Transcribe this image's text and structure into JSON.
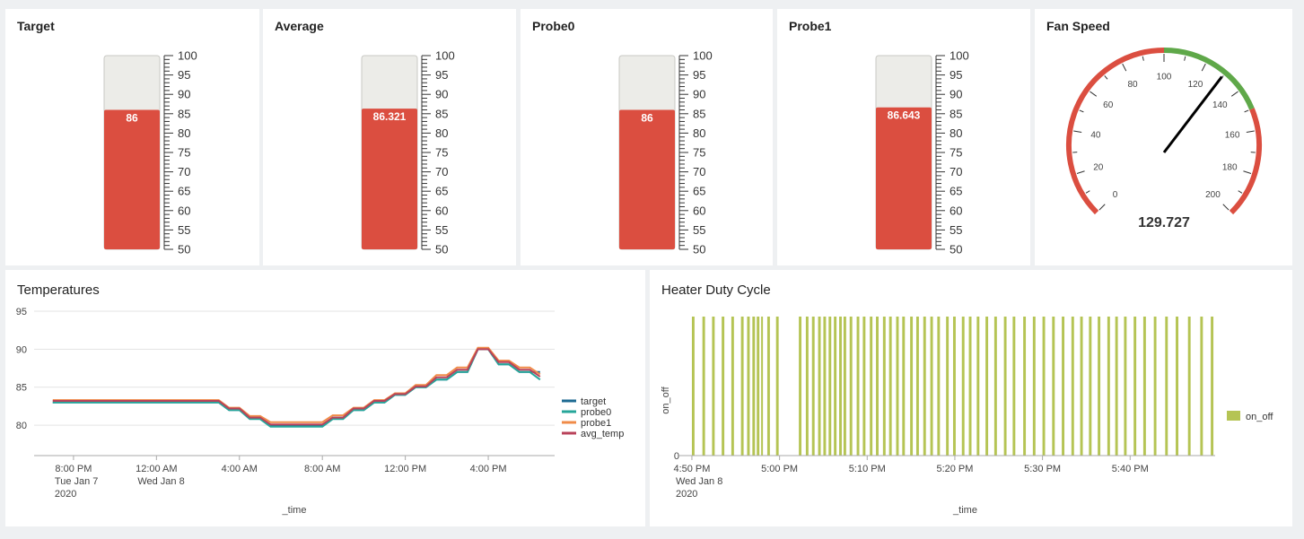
{
  "colors": {
    "red": "#db4e40",
    "green": "#5fa849",
    "empty": "#ecece8",
    "target": "#1d6a92",
    "probe0": "#26a69a",
    "probe1": "#f08b48",
    "avg_temp": "#b9425a",
    "heater": "#b5c454"
  },
  "thermometers": [
    {
      "title": "Target",
      "value": 86,
      "label": "86"
    },
    {
      "title": "Average",
      "value": 86.321,
      "label": "86.321"
    },
    {
      "title": "Probe0",
      "value": 86,
      "label": "86"
    },
    {
      "title": "Probe1",
      "value": 86.643,
      "label": "86.643"
    }
  ],
  "thermo_scale": {
    "min": 50,
    "max": 100,
    "ticks": [
      "100",
      "95",
      "90",
      "85",
      "80",
      "75",
      "70",
      "65",
      "60",
      "55",
      "50"
    ]
  },
  "fan": {
    "title": "Fan Speed",
    "value": 129.727,
    "label": "129.727",
    "min": 0,
    "max": 200,
    "ticks": [
      "0",
      "20",
      "40",
      "60",
      "80",
      "100",
      "120",
      "140",
      "160",
      "180",
      "200"
    ],
    "bands": [
      {
        "from": 0,
        "to": 100,
        "color": "#db4e40"
      },
      {
        "from": 100,
        "to": 150,
        "color": "#5fa849"
      },
      {
        "from": 150,
        "to": 200,
        "color": "#db4e40"
      }
    ]
  },
  "temperatures": {
    "title": "Temperatures",
    "xlabel": "_time",
    "y_ticks": [
      "95",
      "90",
      "85",
      "80"
    ],
    "x_ticks": [
      {
        "l1": "8:00 PM",
        "l2": "Tue Jan 7",
        "l3": "2020"
      },
      {
        "l1": "12:00 AM",
        "l2": "Wed Jan 8",
        "l3": ""
      },
      {
        "l1": "4:00 AM",
        "l2": "",
        "l3": ""
      },
      {
        "l1": "8:00 AM",
        "l2": "",
        "l3": ""
      },
      {
        "l1": "12:00 PM",
        "l2": "",
        "l3": ""
      },
      {
        "l1": "4:00 PM",
        "l2": "",
        "l3": ""
      }
    ],
    "legend": [
      "target",
      "probe0",
      "probe1",
      "avg_temp"
    ]
  },
  "chart_data": [
    {
      "type": "line",
      "title": "Temperatures",
      "xlabel": "_time",
      "ylim": [
        76,
        95
      ],
      "x": [
        -1,
        0,
        1,
        2,
        3,
        4,
        5,
        6,
        7,
        7.5,
        8,
        8.5,
        9,
        9.5,
        10,
        10.5,
        11,
        11.5,
        12,
        12.5,
        13,
        13.5,
        14,
        14.5,
        15,
        15.5,
        16,
        16.5,
        17,
        17.5,
        18,
        18.5,
        19,
        19.5,
        20,
        20.5,
        21,
        21.5,
        22,
        22.5
      ],
      "series": [
        {
          "name": "target",
          "values": [
            83,
            83,
            83,
            83,
            83,
            83,
            83,
            83,
            83,
            82,
            82,
            81,
            81,
            80,
            80,
            80,
            80,
            80,
            80,
            81,
            81,
            82,
            82,
            83,
            83,
            84,
            84,
            85,
            85,
            86,
            86,
            87,
            87,
            90,
            90,
            88,
            88,
            87,
            87,
            87
          ]
        },
        {
          "name": "probe0",
          "values": [
            83,
            83,
            83,
            83,
            83,
            83,
            83,
            83,
            83,
            82,
            82,
            80.8,
            80.8,
            79.8,
            79.8,
            79.8,
            79.8,
            79.8,
            79.8,
            80.8,
            80.8,
            82,
            82,
            83,
            83,
            84,
            84,
            85,
            85,
            86,
            86,
            87,
            87,
            90,
            90,
            88,
            88,
            87,
            87,
            86
          ]
        },
        {
          "name": "probe1",
          "values": [
            83.3,
            83.3,
            83.3,
            83.3,
            83.3,
            83.3,
            83.3,
            83.3,
            83.3,
            82.3,
            82.3,
            81.2,
            81.2,
            80.4,
            80.4,
            80.4,
            80.4,
            80.4,
            80.4,
            81.3,
            81.3,
            82.3,
            82.3,
            83.3,
            83.3,
            84.2,
            84.2,
            85.3,
            85.3,
            86.6,
            86.6,
            87.6,
            87.6,
            90.2,
            90.2,
            88.5,
            88.5,
            87.6,
            87.6,
            86.7
          ]
        },
        {
          "name": "avg_temp",
          "values": [
            83.2,
            83.2,
            83.2,
            83.2,
            83.2,
            83.2,
            83.2,
            83.2,
            83.2,
            82.2,
            82.2,
            81,
            81,
            80.1,
            80.1,
            80.1,
            80.1,
            80.1,
            80.1,
            81,
            81,
            82.2,
            82.2,
            83.2,
            83.2,
            84.1,
            84.1,
            85.1,
            85.1,
            86.3,
            86.3,
            87.3,
            87.3,
            90,
            90,
            88.3,
            88.3,
            87.3,
            87.3,
            86.4
          ]
        }
      ]
    },
    {
      "type": "bar",
      "title": "Heater Duty Cycle",
      "xlabel": "_time",
      "ylabel": "on_off",
      "ylim": [
        0,
        1
      ],
      "legend": [
        "on_off"
      ],
      "on_intervals_minutes": [
        [
          0.0,
          0.3
        ],
        [
          1.2,
          1.5
        ],
        [
          2.3,
          2.6
        ],
        [
          3.4,
          3.7
        ],
        [
          4.5,
          4.8
        ],
        [
          5.6,
          5.9
        ],
        [
          6.3,
          6.6
        ],
        [
          6.9,
          7.2
        ],
        [
          7.4,
          7.7
        ],
        [
          7.9,
          8.1
        ],
        [
          8.6,
          8.9
        ],
        [
          9.6,
          9.9
        ],
        [
          12.2,
          12.5
        ],
        [
          13.0,
          13.3
        ],
        [
          13.7,
          14.0
        ],
        [
          14.4,
          14.7
        ],
        [
          15.0,
          15.3
        ],
        [
          15.6,
          15.9
        ],
        [
          16.2,
          16.5
        ],
        [
          16.8,
          17.1
        ],
        [
          17.3,
          17.6
        ],
        [
          18.0,
          18.3
        ],
        [
          18.8,
          19.1
        ],
        [
          19.5,
          19.8
        ],
        [
          20.3,
          20.6
        ],
        [
          21.0,
          21.3
        ],
        [
          21.8,
          22.1
        ],
        [
          22.5,
          22.8
        ],
        [
          23.3,
          23.6
        ],
        [
          24.0,
          24.3
        ],
        [
          24.9,
          25.2
        ],
        [
          25.6,
          25.9
        ],
        [
          26.4,
          26.7
        ],
        [
          27.2,
          27.5
        ],
        [
          28.0,
          28.3
        ],
        [
          29.0,
          29.3
        ],
        [
          29.8,
          30.1
        ],
        [
          30.8,
          31.1
        ],
        [
          31.6,
          31.9
        ],
        [
          32.5,
          32.8
        ],
        [
          33.5,
          33.8
        ],
        [
          34.5,
          34.8
        ],
        [
          35.6,
          35.9
        ],
        [
          36.6,
          36.9
        ],
        [
          37.8,
          38.1
        ],
        [
          38.9,
          39.2
        ],
        [
          40.0,
          40.3
        ],
        [
          41.1,
          41.4
        ],
        [
          42.2,
          42.5
        ],
        [
          43.3,
          43.6
        ],
        [
          44.3,
          44.6
        ],
        [
          45.3,
          45.6
        ],
        [
          46.3,
          46.6
        ],
        [
          47.4,
          47.7
        ],
        [
          48.3,
          48.6
        ],
        [
          49.3,
          49.6
        ],
        [
          50.4,
          50.7
        ],
        [
          51.5,
          51.8
        ],
        [
          52.7,
          53.0
        ],
        [
          54.0,
          54.3
        ],
        [
          55.2,
          55.5
        ],
        [
          56.6,
          56.9
        ],
        [
          58.0,
          58.3
        ],
        [
          59.2,
          59.5
        ]
      ]
    }
  ],
  "heater": {
    "title": "Heater Duty Cycle",
    "xlabel": "_time",
    "ylabel": "on_off",
    "y_ticks": [
      "0"
    ],
    "x_ticks": [
      {
        "l1": "4:50 PM",
        "l2": "Wed Jan 8",
        "l3": "2020"
      },
      {
        "l1": "5:00 PM",
        "l2": "",
        "l3": ""
      },
      {
        "l1": "5:10 PM",
        "l2": "",
        "l3": ""
      },
      {
        "l1": "5:20 PM",
        "l2": "",
        "l3": ""
      },
      {
        "l1": "5:30 PM",
        "l2": "",
        "l3": ""
      },
      {
        "l1": "5:40 PM",
        "l2": "",
        "l3": ""
      }
    ],
    "legend": [
      "on_off"
    ]
  }
}
